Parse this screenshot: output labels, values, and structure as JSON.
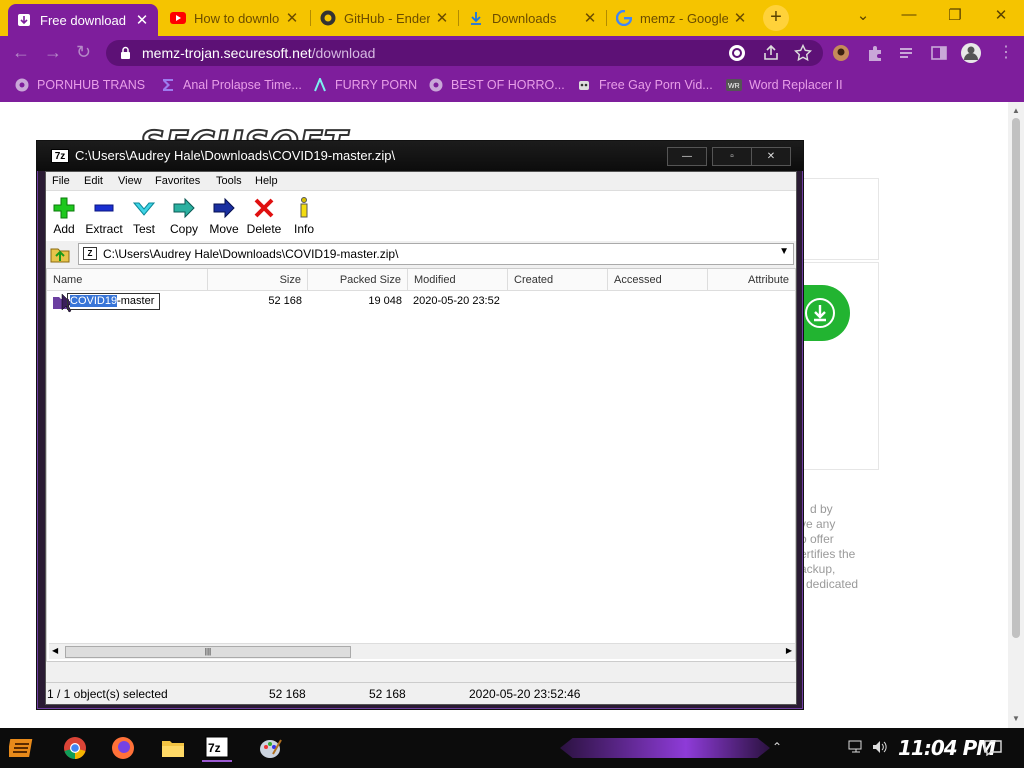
{
  "browser": {
    "tabs": [
      {
        "title": "Free download",
        "favicon": "download-icon",
        "active": true
      },
      {
        "title": "How to downlo",
        "favicon": "youtube-icon",
        "active": false
      },
      {
        "title": "GitHub - Ender",
        "favicon": "github-icon",
        "active": false
      },
      {
        "title": "Downloads",
        "favicon": "download-arrow-icon",
        "active": false
      },
      {
        "title": "memz - Google",
        "favicon": "google-icon",
        "active": false
      }
    ],
    "url": {
      "host": "memz-trojan.securesoft.net",
      "path": "/download"
    },
    "bookmarks": [
      {
        "label": "PORNHUB TRANS",
        "icon": "globe-icon"
      },
      {
        "label": "Anal Prolapse Time...",
        "icon": "sigma-icon"
      },
      {
        "label": "FURRY PORN",
        "icon": "lambda-icon"
      },
      {
        "label": "BEST OF HORRO...",
        "icon": "globe-icon"
      },
      {
        "label": "Free Gay Porn Vid...",
        "icon": "robot-icon"
      },
      {
        "label": "Word Replacer II",
        "icon": "wr-icon"
      }
    ],
    "colors": {
      "tabstrip": "#f5c400",
      "toolbar": "#7e1e9c",
      "bookmark_text": "#e89ee8"
    }
  },
  "page": {
    "logo": "SECUSOFT",
    "text_lines": [
      "d by",
      "ve any",
      "o offer",
      "ertifies the",
      "ackup,",
      "dedicated"
    ]
  },
  "sevenzip": {
    "title": "C:\\Users\\Audrey Hale\\Downloads\\COVID19-master.zip\\",
    "title_icon": "7z",
    "menu": [
      "File",
      "Edit",
      "View",
      "Favorites",
      "Tools",
      "Help"
    ],
    "tools": [
      "Add",
      "Extract",
      "Test",
      "Copy",
      "Move",
      "Delete",
      "Info"
    ],
    "path": "C:\\Users\\Audrey Hale\\Downloads\\COVID19-master.zip\\",
    "columns": [
      "Name",
      "Size",
      "Packed Size",
      "Modified",
      "Created",
      "Accessed",
      "Attribute"
    ],
    "rows": [
      {
        "name_selected": "COVID19",
        "name_rest": "-master",
        "size": "52 168",
        "packed": "19 048",
        "modified": "2020-05-20 23:52",
        "created": "",
        "accessed": ""
      }
    ],
    "status": {
      "selection": "1 / 1 object(s) selected",
      "size": "52 168",
      "packed": "52 168",
      "modified": "2020-05-20 23:52:46"
    }
  },
  "taskbar": {
    "apps": [
      "start-icon",
      "chrome-icon",
      "firefox-icon",
      "file-explorer-icon",
      "7zip-icon",
      "paint-icon"
    ],
    "clock": "11:04 PM"
  }
}
